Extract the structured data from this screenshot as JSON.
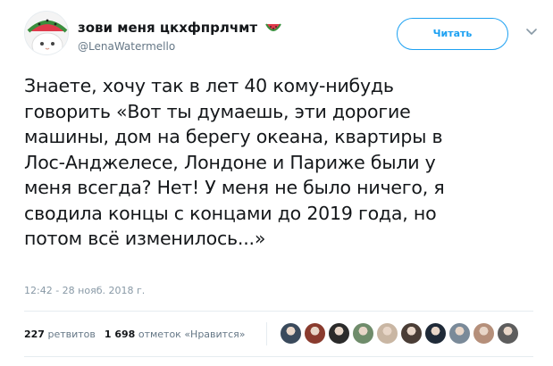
{
  "author": {
    "display_name": "зови меня цкхфпрлчмт",
    "handle": "@LenaWatermello",
    "avatar_icon": "watermelon-cat-avatar",
    "name_emoji_icon": "watermelon-icon"
  },
  "actions": {
    "follow_label": "Читать",
    "menu_icon": "chevron-down-icon"
  },
  "tweet": {
    "text": "Знаете, хочу так в лет 40 кому-нибудь\nговорить «Вот ты думаешь, эти дорогие\nмашины, дом на берегу океана, квартиры в\nЛос-Анджелесе, Лондоне и Париже были у\nменя всегда? Нет! У меня не было ничего, я\nсводила концы с концами до 2019 года, но\nпотом всё изменилось...»",
    "timestamp": "12:42 - 28 нояб. 2018 г."
  },
  "stats": {
    "retweets_count": "227",
    "retweets_label": "ретвитов",
    "likes_count": "1 698",
    "likes_label": "отметок «Нравится»"
  },
  "likers": [
    {
      "name": "liker-avatar-1",
      "color": "#3a4a5c"
    },
    {
      "name": "liker-avatar-2",
      "color": "#8a3b2e"
    },
    {
      "name": "liker-avatar-3",
      "color": "#2b2b2b"
    },
    {
      "name": "liker-avatar-4",
      "color": "#6f8c6b"
    },
    {
      "name": "liker-avatar-5",
      "color": "#c9b6a3"
    },
    {
      "name": "liker-avatar-6",
      "color": "#4a3d36"
    },
    {
      "name": "liker-avatar-7",
      "color": "#1f2a38"
    },
    {
      "name": "liker-avatar-8",
      "color": "#7a8a99"
    },
    {
      "name": "liker-avatar-9",
      "color": "#b58f7a"
    },
    {
      "name": "liker-avatar-10",
      "color": "#5d5d5d"
    }
  ],
  "colors": {
    "accent": "#1da1f2",
    "text": "#14171a",
    "muted": "#657786",
    "divider": "#e6ecf0"
  }
}
